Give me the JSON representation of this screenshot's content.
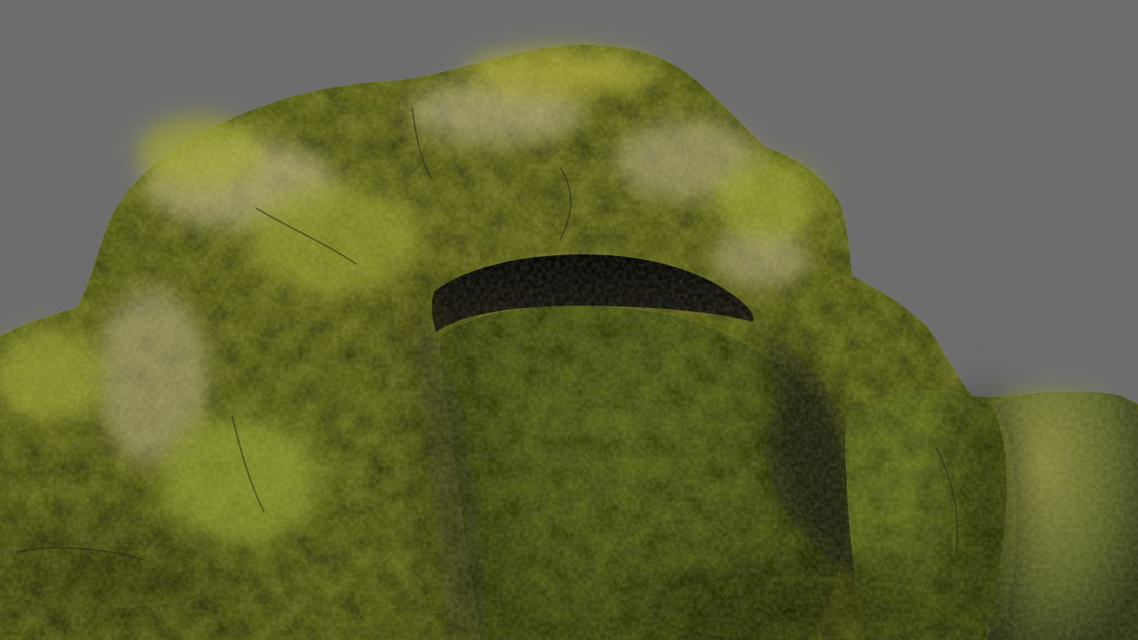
{
  "scene": {
    "subject": "moss-covered-rock-cave",
    "background_color": "#6d6d6d",
    "colors": {
      "moss_light": "#a8a43c",
      "moss_mid": "#6e7a2a",
      "moss_dark": "#3f4a1c",
      "rock_light": "#b6a889",
      "rock_mid": "#6f6a4e",
      "rock_dark": "#2f2d1f",
      "cave_shadow": "#0d0b08"
    }
  }
}
